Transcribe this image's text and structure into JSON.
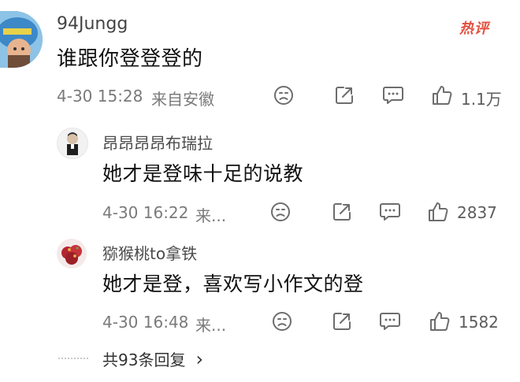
{
  "main_comment": {
    "username": "94Jungg",
    "text": "谁跟你登登登的",
    "time": "4-30 15:28",
    "location": "来自安徽",
    "likes": "1.1万",
    "badge": "热评"
  },
  "replies": [
    {
      "username": "昂昂昂昂布瑞拉",
      "text": "她才是登味十足的说教",
      "time": "4-30 16:22",
      "location": "来...",
      "likes": "2837"
    },
    {
      "username": "猕猴桃to拿铁",
      "text": "她才是登，喜欢写小作文的登",
      "time": "4-30 16:48",
      "location": "来...",
      "likes": "1582"
    }
  ],
  "more_replies": {
    "label": "共93条回复",
    "arrow": "›"
  },
  "icons": {
    "dislike": "dislike-face-icon",
    "share": "share-icon",
    "comment": "comment-icon",
    "like": "thumbs-up-icon"
  },
  "colors": {
    "badge": "#e2503f",
    "meta": "#7a7a7a",
    "icon": "#6d6d6d"
  }
}
